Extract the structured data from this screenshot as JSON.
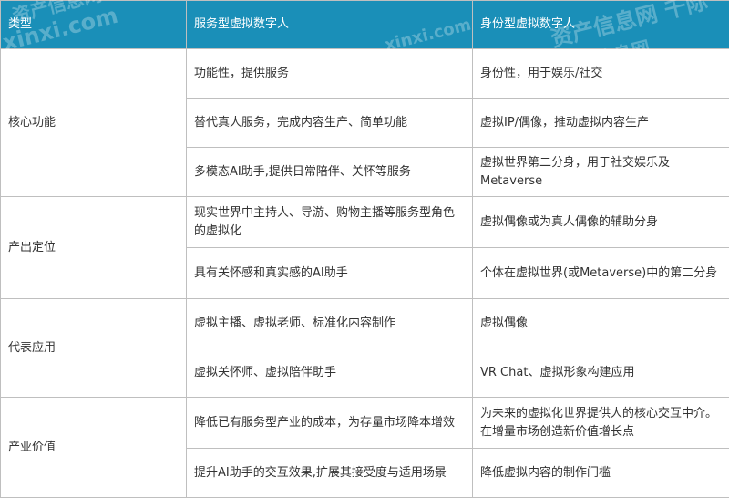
{
  "table": {
    "headers": [
      "类型",
      "服务型虚拟数字人",
      "身份型虚拟数字人"
    ],
    "groups": [
      {
        "category": "核心功能",
        "rows": [
          [
            "功能性，提供服务",
            "身份性，用于娱乐/社交"
          ],
          [
            "替代真人服务，完成内容生产、简单功能",
            "虚拟IP/偶像，推动虚拟内容生产"
          ],
          [
            "多模态AI助手,提供日常陪伴、关怀等服务",
            "虚拟世界第二分身，用于社交娱乐及Metaverse"
          ]
        ]
      },
      {
        "category": "产出定位",
        "rows": [
          [
            "现实世界中主持人、导游、购物主播等服务型角色的虚拟化",
            "虚拟偶像或为真人偶像的辅助分身"
          ],
          [
            "具有关怀感和真实感的AI助手",
            "个体在虚拟世界(或Metaverse)中的第二分身"
          ]
        ]
      },
      {
        "category": "代表应用",
        "rows": [
          [
            "虚拟主播、虚拟老师、标准化内容制作",
            "虚拟偶像"
          ],
          [
            "虚拟关怀师、虚拟陪伴助手",
            "VR Chat、虚拟形象构建应用"
          ]
        ]
      },
      {
        "category": "产业价值",
        "rows": [
          [
            "降低已有服务型产业的成本，为存量市场降本增效",
            "为未来的虚拟化世界提供人的核心交互中介。在增量市场创造新价值增长点"
          ],
          [
            "提升AI助手的交互效果,扩展其接受度与适用场景",
            "降低虚拟内容的制作门槛"
          ]
        ]
      }
    ]
  },
  "watermark": {
    "text_left": "资产信息网",
    "text_left_url": "xinxi.com",
    "text_right": "资产信息网 千际",
    "text_right2": "资产信息网",
    "text_right2_url": "xinxi.com"
  },
  "colors": {
    "header_bg": "#1a8fb8",
    "header_text": "#ffffff",
    "border": "#bfbfbf",
    "body_text": "#333333"
  }
}
